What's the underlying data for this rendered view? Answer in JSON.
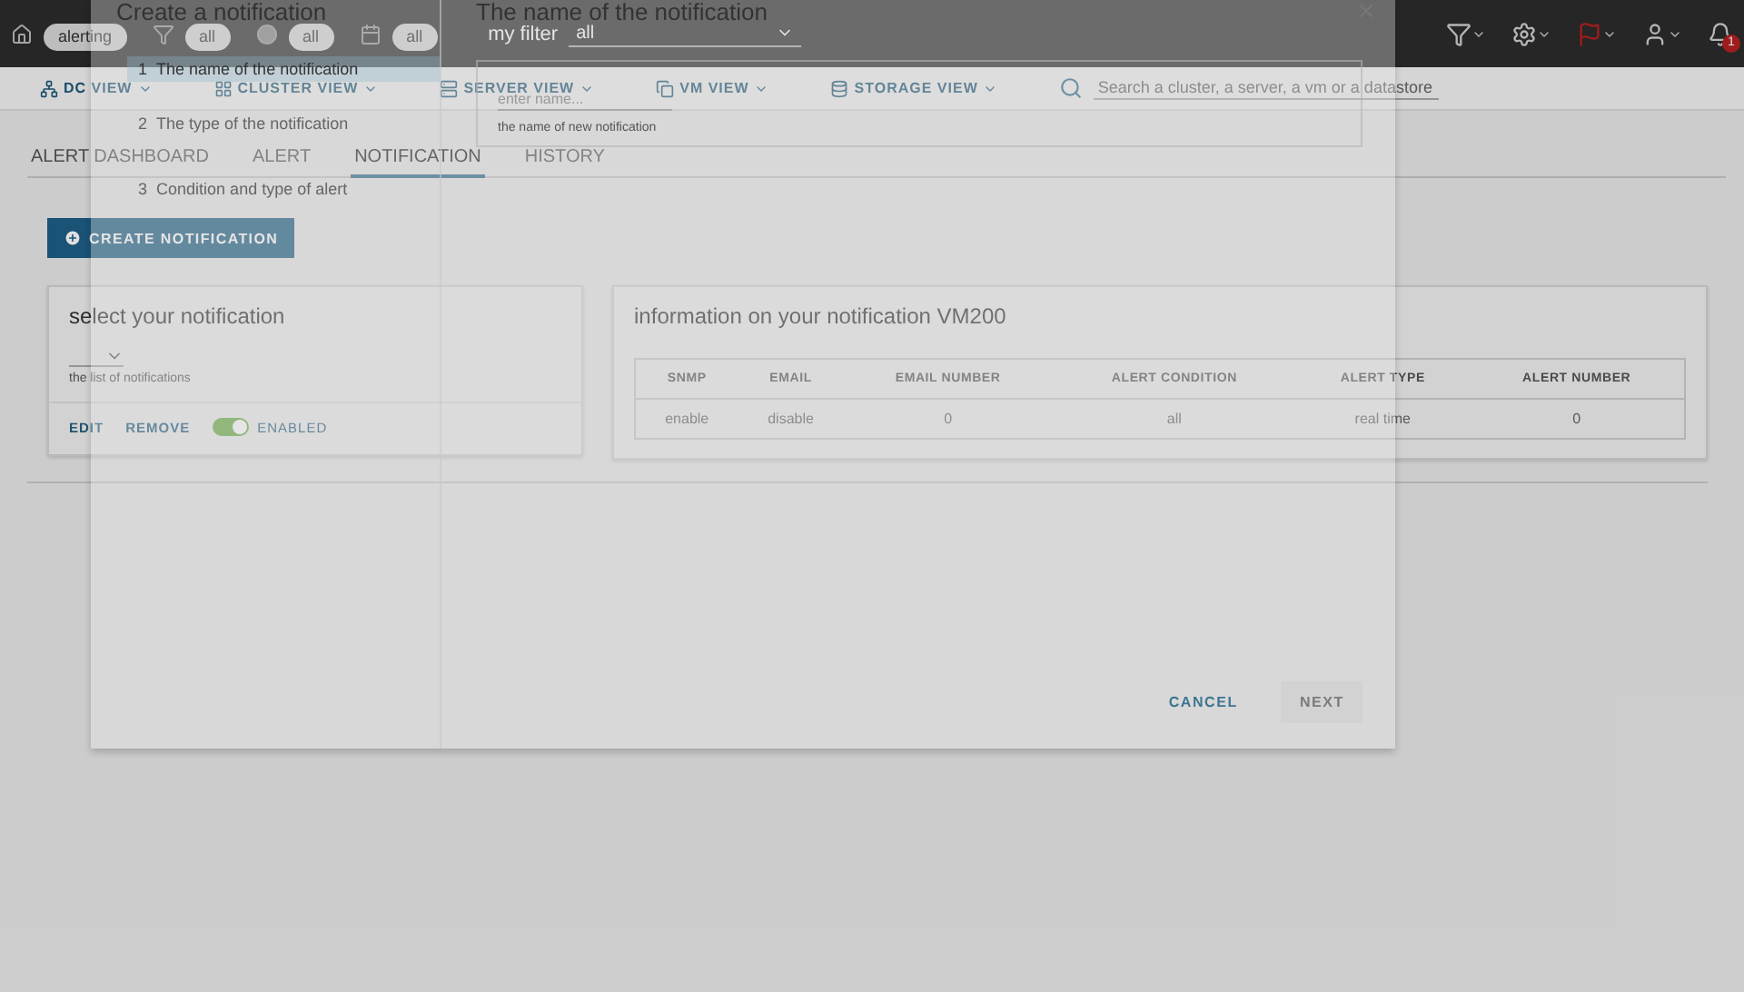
{
  "top_bar": {
    "context": "alerting",
    "filters": [
      {
        "kind": "filter",
        "value": "all"
      },
      {
        "kind": "status",
        "value": "all"
      },
      {
        "kind": "date",
        "value": "all"
      }
    ],
    "my_filter": {
      "label": "my filter",
      "value": "all"
    },
    "notifications_badge": "1"
  },
  "nav": {
    "items": [
      {
        "kind": "dc",
        "label": "DC VIEW"
      },
      {
        "kind": "cluster",
        "label": "CLUSTER VIEW"
      },
      {
        "kind": "server",
        "label": "SERVER VIEW"
      },
      {
        "kind": "vm",
        "label": "VM VIEW"
      },
      {
        "kind": "storage",
        "label": "STORAGE VIEW"
      }
    ],
    "search": {
      "placeholder": "Search a cluster, a server, a vm or a datastore"
    }
  },
  "tabs": [
    {
      "label": "ALERT DASHBOARD",
      "selected": false
    },
    {
      "label": "ALERT",
      "selected": false
    },
    {
      "label": "NOTIFICATION",
      "selected": true
    },
    {
      "label": "HISTORY",
      "selected": false
    }
  ],
  "create_button": "CREATE NOTIFICATION",
  "select_card": {
    "title": "select your notification",
    "helper": "the list of notifications",
    "actions": [
      "EDIT",
      "REMOVE"
    ],
    "toggle": {
      "label": "ENABLED",
      "on": true
    }
  },
  "info_card": {
    "title": "information on your notification VM200",
    "table": {
      "columns": [
        "SNMP",
        "EMAIL",
        "EMAIL NUMBER",
        "ALERT CONDITION",
        "ALERT TYPE",
        "ALERT NUMBER"
      ],
      "rows": [
        [
          "enable",
          "disable",
          "0",
          "all",
          "real time",
          "0"
        ]
      ]
    }
  },
  "modal": {
    "title": "Create a notification",
    "steps": [
      {
        "number": "1",
        "label": "The name of the notification",
        "selected": true
      },
      {
        "number": "2",
        "label": "The type of the notification",
        "selected": false
      },
      {
        "number": "3",
        "label": "Condition and type of alert",
        "selected": false
      }
    ],
    "section_title": "The name of the notification",
    "name_field": {
      "placeholder": "enter name...",
      "helper": "the name of new notification"
    },
    "buttons": [
      {
        "label": "CANCEL",
        "disabled": false
      },
      {
        "label": "NEXT",
        "disabled": true
      }
    ]
  }
}
